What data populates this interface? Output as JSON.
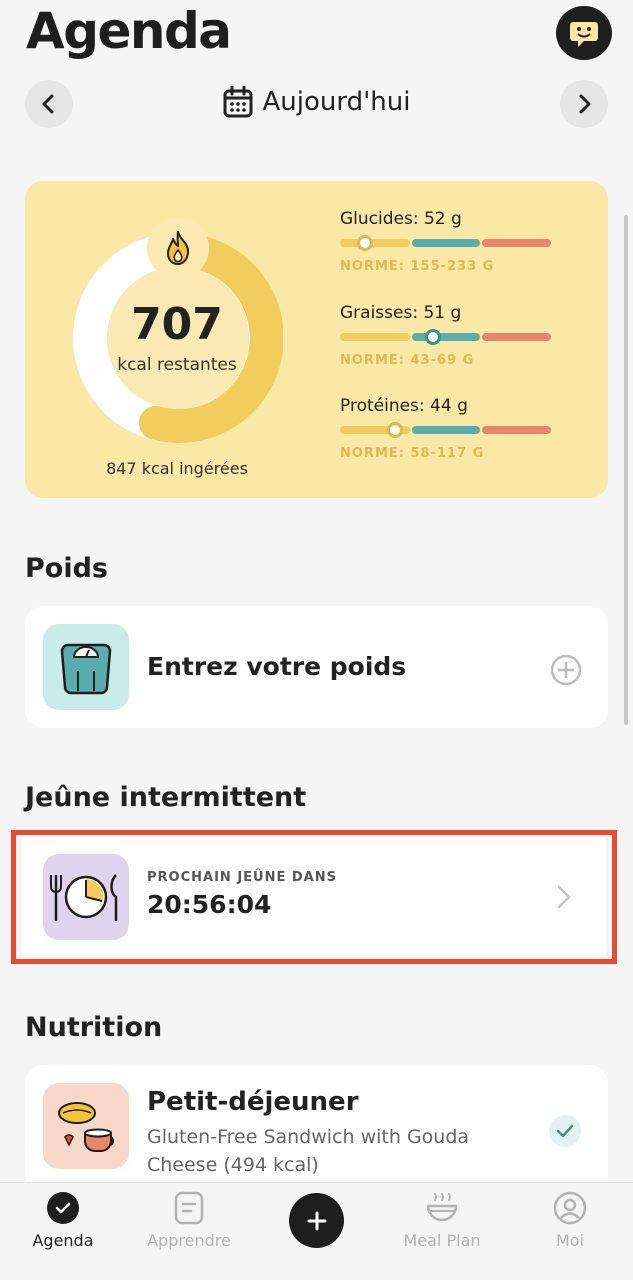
{
  "header": {
    "title": "Agenda",
    "date_label": "Aujourd'hui"
  },
  "summary": {
    "kcal_remaining": "707",
    "kcal_remaining_label": "kcal restantes",
    "kcal_eaten_label": "847 kcal ingérées",
    "macros": [
      {
        "label": "Glucides: 52 g",
        "norm": "NORME: 155-233 G",
        "position_fraction": 0.12,
        "thumb_color": "#e0b84f"
      },
      {
        "label": "Graisses: 51 g",
        "norm": "NORME: 43-69 G",
        "position_fraction": 0.44,
        "thumb_color": "#3f8f8e"
      },
      {
        "label": "Protéines: 44 g",
        "norm": "NORME: 58-117 G",
        "position_fraction": 0.26,
        "thumb_color": "#e0b84f"
      }
    ]
  },
  "weight": {
    "section_title": "Poids",
    "action_label": "Entrez votre poids"
  },
  "fasting": {
    "section_title": "Jeûne intermittent",
    "caption": "PROCHAIN JEÛNE DANS",
    "timer": "20:56:04"
  },
  "nutrition": {
    "section_title": "Nutrition",
    "meal": {
      "title": "Petit-déjeuner",
      "description": "Gluten-Free Sandwich with Gouda Cheese (494 kcal)"
    }
  },
  "tabbar": {
    "items": [
      {
        "label": "Agenda",
        "icon": "check-circle-icon",
        "active": true
      },
      {
        "label": "Apprendre",
        "icon": "document-icon",
        "active": false
      },
      {
        "label": "Meal Plan",
        "icon": "bowl-icon",
        "active": false
      },
      {
        "label": "Moi",
        "icon": "profile-icon",
        "active": false
      }
    ]
  },
  "colors": {
    "accent_yellow": "#f0cd5c",
    "card_bg": "#fae8a6",
    "teal": "#5aadac",
    "coral": "#e78669",
    "highlight": "#e84a35"
  }
}
